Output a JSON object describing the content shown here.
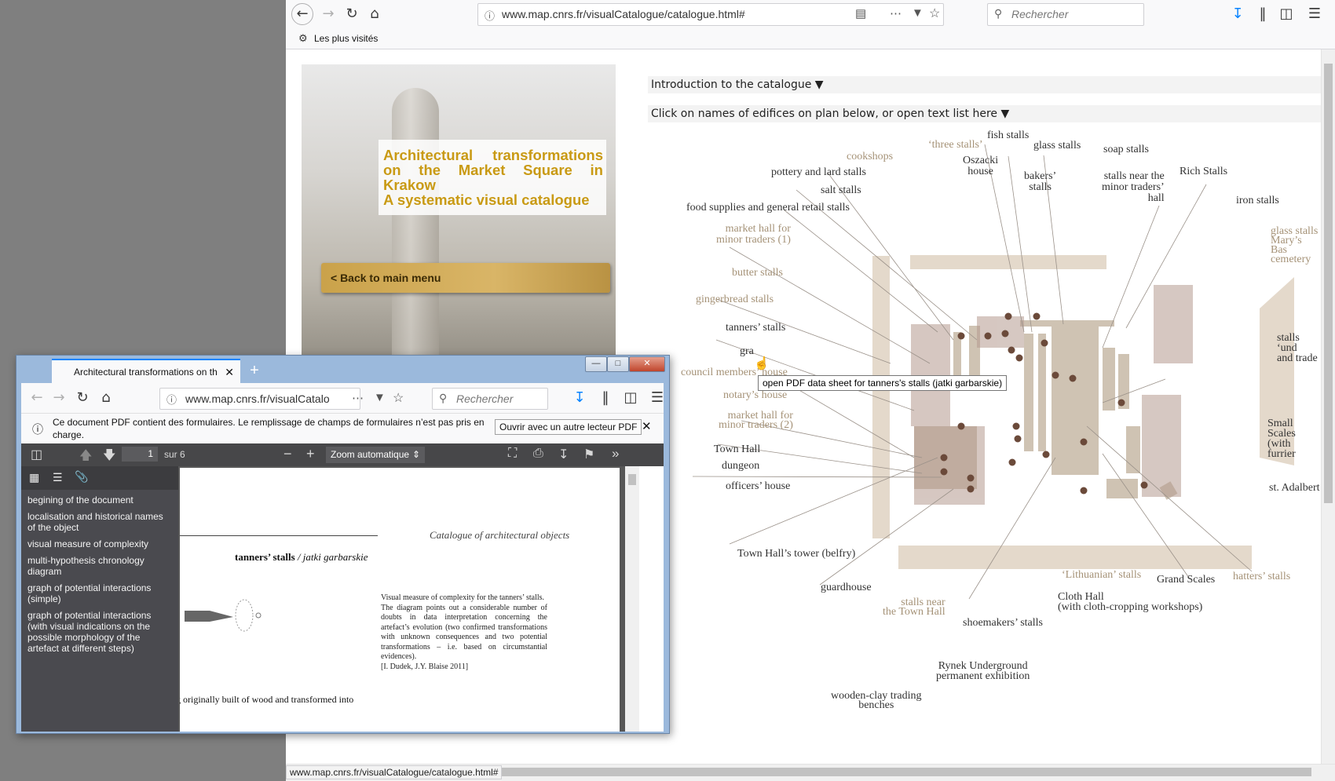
{
  "main_browser": {
    "url": "www.map.cnrs.fr/visualCatalogue/catalogue.html#",
    "search_placeholder": "Rechercher",
    "bookmark_label": "Les plus visités",
    "status_url": "www.map.cnrs.fr/visualCatalogue/catalogue.html#"
  },
  "hero": {
    "title_line1": "Architectural transformations on the Market Square in Krakow",
    "title_line2": "A systematic visual catalogue",
    "back_label": "< Back to main menu"
  },
  "sections": {
    "intro": "Introduction to the catalogue ▼",
    "list": "Click on names of edifices on plan below, or open text list here ▼"
  },
  "plan_labels": {
    "fish_stalls": "fish stalls",
    "three_stalls": "‘three stalls’",
    "glass_stalls": "glass stalls",
    "soap_stalls": "soap stalls",
    "cookshops": "cookshops",
    "oszacki": "Oszacki\nhouse",
    "bakers": "bakers’\nstalls",
    "near_minor": "stalls near the\nminor traders’\nhall",
    "rich": "Rich Stalls",
    "pottery": "pottery and lard stalls",
    "salt": "salt stalls",
    "iron": "iron stalls",
    "food": "food supplies and general retail stalls",
    "market_hall_1": "market hall for\nminor traders (1)",
    "glass_stalls_2": "glass stalls\nMary’s Bas\ncemetery",
    "butter": "butter stalls",
    "gingerbread": "gingerbread stalls",
    "tanners": "tanners’ stalls",
    "gra": "gra",
    "stalls_und": "stalls ‘und\nand trade",
    "council": "council members’ house",
    "notary": "notary’s house",
    "market_hall_2": "market hall for\nminor traders (2)",
    "small_scales": "Small Scales\n(with furrier",
    "town_hall": "Town Hall",
    "dungeon": "dungeon",
    "officers": "officers’ house",
    "adalbert": "st. Adalbert",
    "tower": "Town Hall’s tower (belfry)",
    "lithuanian": "‘Lithuanian’ stalls",
    "grand_scales": "Grand Scales",
    "hatters": "hatters’ stalls",
    "guardhouse": "guardhouse",
    "near_town_hall": "stalls near\nthe Town Hall",
    "cloth_hall": "Cloth Hall\n(with cloth-cropping workshops)",
    "shoemakers": "shoemakers’ stalls",
    "rynek": "Rynek Underground\npermanent exhibition",
    "wooden": "wooden-clay trading\nbenches"
  },
  "tooltip": "open PDF data sheet for tanners's stalls (jatki garbarskie)",
  "pdf_window": {
    "tab_title": "Architectural transformations on th",
    "url": "www.map.cnrs.fr/visualCatalo",
    "search_placeholder": "Rechercher",
    "notice": "Ce document PDF contient des formulaires. Le remplissage de champs de formulaires n’est pas pris en charge.",
    "open_other": "Ouvrir avec un autre lecteur PDF",
    "page_number": "1",
    "page_total": "sur 6",
    "zoom": "Zoom automatique",
    "outline": [
      "begining of the document",
      "localisation and historical names of the object",
      "visual measure of complexity",
      "multi-hypothesis chronology diagram",
      "graph of potential interactions (simple)",
      "graph of potential interactions (with visual indications on the possible morphology of the artefact at different steps)"
    ],
    "page": {
      "header": "Catalogue of architectural objects",
      "title_bold": "tanners’ stalls",
      "title_italic": " / jatki garbarskie",
      "caption_line1": "Visual measure of complexity for the tanners’ stalls.",
      "caption_body": "The diagram points out a considerable number of doubts in data interpretation concerning the artefact’s evolution (two confirmed transformations with unknown consequences and two potential transformations – i.e. based on circumstantial evidences).",
      "caption_ref": "[I. Dudek, J.Y. Blaise 2011]",
      "footer_text": "A single-storey building originally built of wood and transformed into"
    }
  },
  "colors": {
    "hero_title": "#c99a14",
    "plan_building": "#cfc3b3",
    "plan_dot": "#6b4a3a",
    "plan_line": "#9a9189",
    "label_muted": "#a59277"
  }
}
